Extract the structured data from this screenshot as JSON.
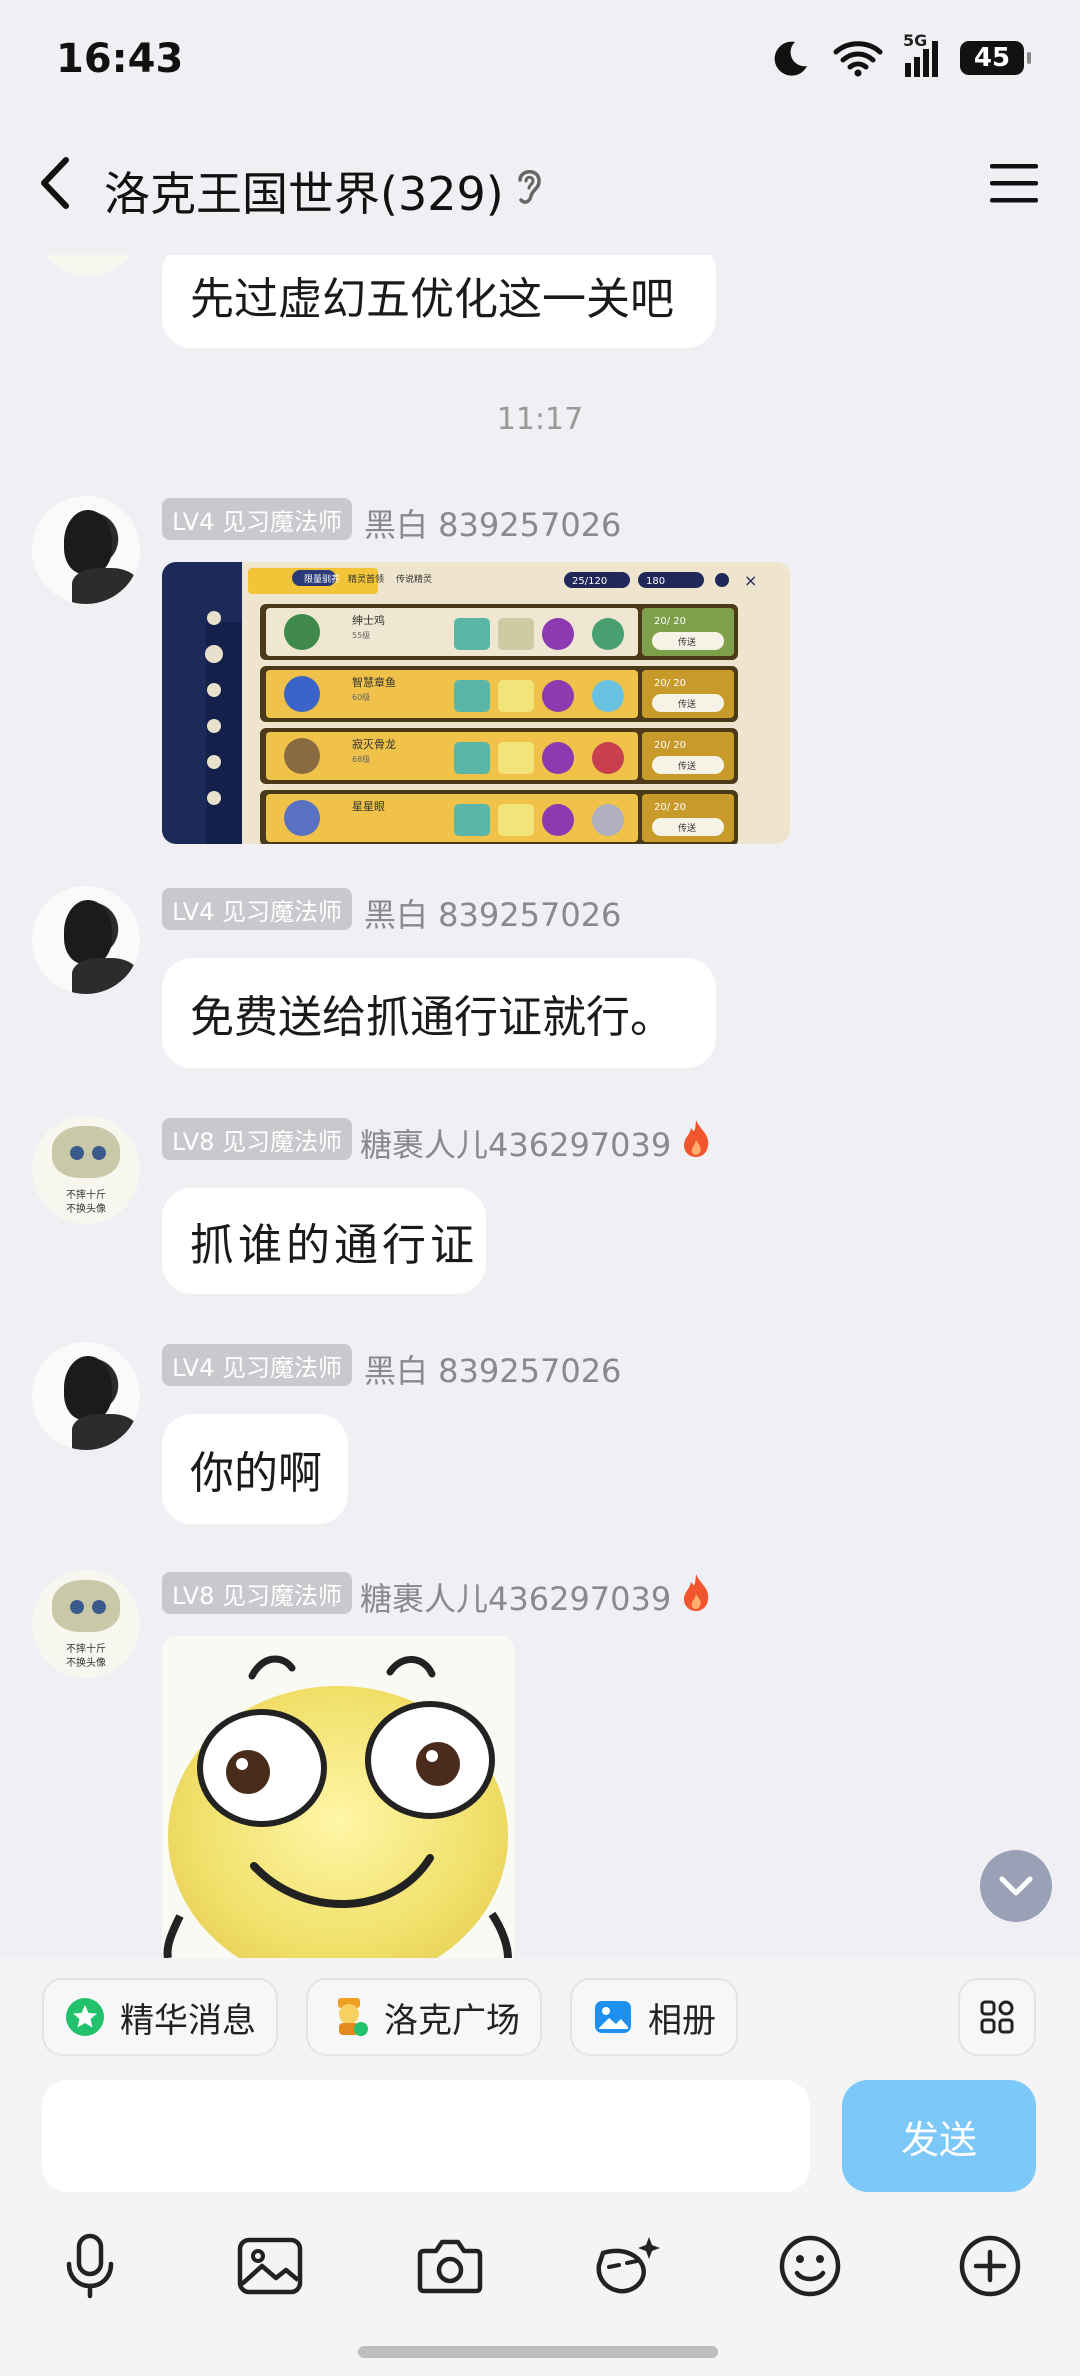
{
  "status_bar": {
    "time": "16:43",
    "network": "5G",
    "battery": "45"
  },
  "header": {
    "title": "洛克王国世界(329)"
  },
  "messages": {
    "m0": {
      "text": "先过虚幻五优化这一关吧"
    },
    "timestamp": "11:17",
    "m1": {
      "badge": "LV4 见习魔法师",
      "name": "黑白 839257026"
    },
    "m2": {
      "badge": "LV4 见习魔法师",
      "name": "黑白 839257026",
      "text": "免费送给抓通行证就行。"
    },
    "m3": {
      "badge": "LV8 见习魔法师",
      "name": "糖裹人儿436297039",
      "text": "抓谁的通行证"
    },
    "m4": {
      "badge": "LV4 见习魔法师",
      "name": "黑白 839257026",
      "text": "你的啊"
    },
    "m5": {
      "badge": "LV8 见习魔法师",
      "name": "糖裹人儿436297039"
    }
  },
  "avatar_cat_text": [
    "不摔十斤",
    "不换头像"
  ],
  "game_image": {
    "tabs": [
      "限量驯养",
      "精灵首领",
      "传说精灵"
    ],
    "counters": [
      "25/120",
      "180"
    ],
    "rows": [
      {
        "name": "绅士鸡",
        "level": "55级",
        "count": "20/ 20",
        "action": "传送"
      },
      {
        "name": "智慧章鱼",
        "level": "60级",
        "count": "20/ 20",
        "action": "传送"
      },
      {
        "name": "寂灭骨龙",
        "level": "68级",
        "count": "20/ 20",
        "action": "传送"
      },
      {
        "name": "星星眼",
        "level": "",
        "count": "20/ 20",
        "action": "传送"
      }
    ]
  },
  "shortcuts": {
    "essence": "精华消息",
    "square": "洛克广场",
    "album": "相册"
  },
  "composer": {
    "placeholder": "",
    "send": "发送"
  },
  "colors": {
    "send": "#7cc8f8",
    "badge": "#c8c8cd",
    "background": "#f0f0f4"
  }
}
